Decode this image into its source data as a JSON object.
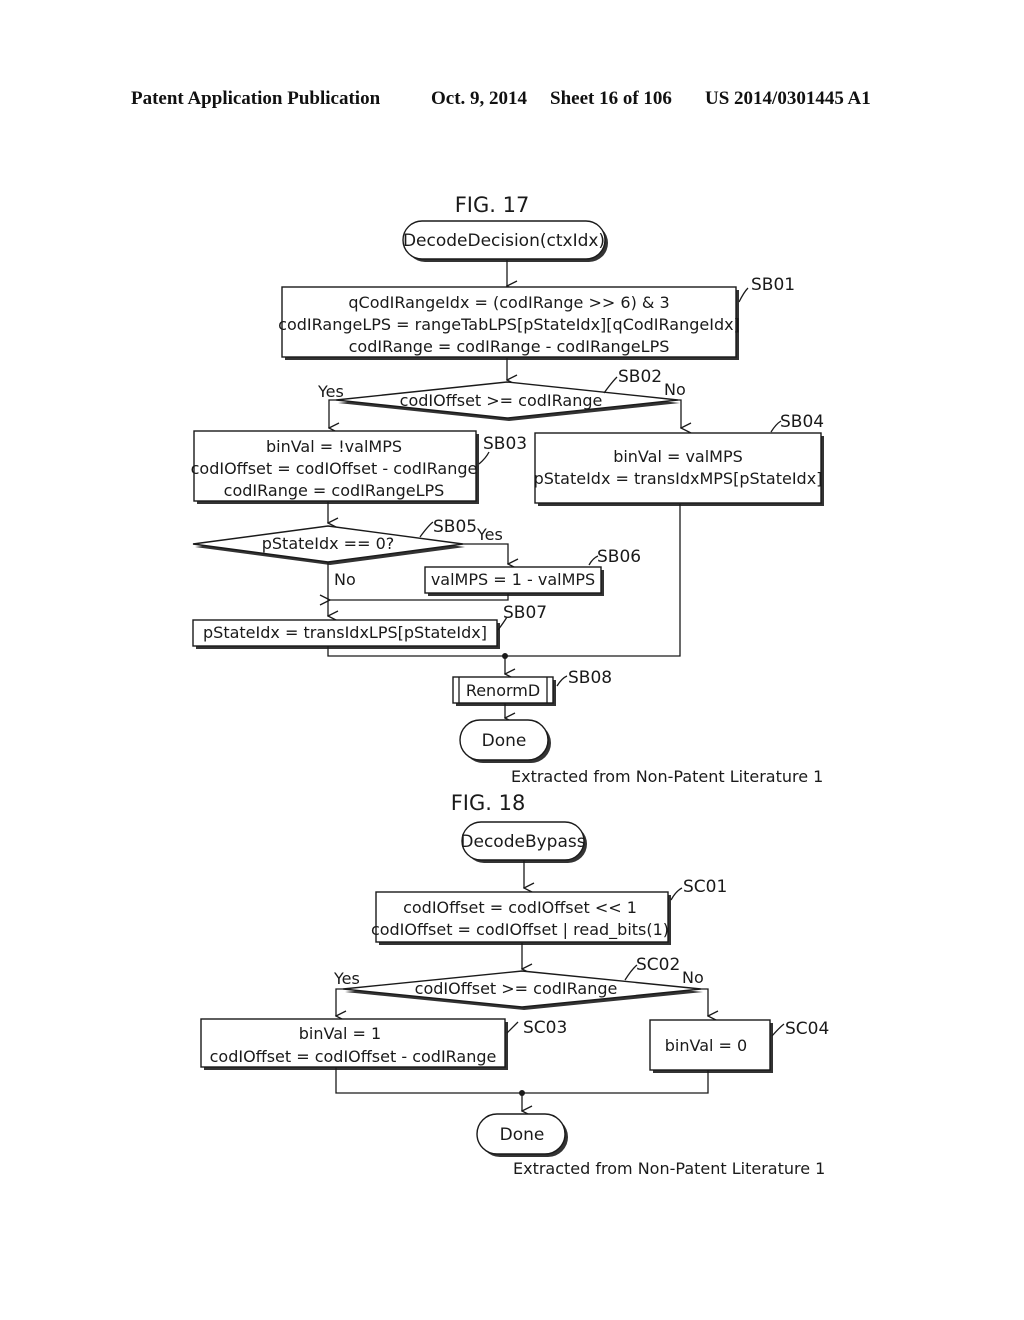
{
  "header": {
    "publication": "Patent Application Publication",
    "date": "Oct. 9, 2014",
    "sheet": "Sheet 16 of 106",
    "number": "US 2014/0301445 A1"
  },
  "fig17": {
    "title": "FIG. 17",
    "start": "DecodeDecision(ctxIdx)",
    "sb01": {
      "label": "SB01",
      "lines": [
        "qCodIRangeIdx = (codIRange >> 6) & 3",
        "codIRangeLPS = rangeTabLPS[pStateIdx][qCodIRangeIdx]",
        "codIRange = codIRange - codIRangeLPS"
      ]
    },
    "sb02": {
      "label": "SB02",
      "condition": "codIOffset >= codIRange",
      "yes": "Yes",
      "no": "No"
    },
    "sb03": {
      "label": "SB03",
      "lines": [
        "binVal = !valMPS",
        "codIOffset = codIOffset - codIRange",
        "codIRange = codIRangeLPS"
      ]
    },
    "sb04": {
      "label": "SB04",
      "lines": [
        "binVal = valMPS",
        "pStateIdx = transIdxMPS[pStateIdx]"
      ]
    },
    "sb05": {
      "label": "SB05",
      "condition": "pStateIdx == 0?",
      "yes": "Yes",
      "no": "No"
    },
    "sb06": {
      "label": "SB06",
      "text": "valMPS = 1 - valMPS"
    },
    "sb07": {
      "label": "SB07",
      "text": "pStateIdx = transIdxLPS[pStateIdx]"
    },
    "sb08": {
      "label": "SB08",
      "text": "RenormD"
    },
    "end": "Done",
    "note": "Extracted from Non-Patent Literature 1"
  },
  "fig18": {
    "title": "FIG. 18",
    "start": "DecodeBypass",
    "sc01": {
      "label": "SC01",
      "lines": [
        "codIOffset = codIOffset << 1",
        "codIOffset = codIOffset | read_bits(1)"
      ]
    },
    "sc02": {
      "label": "SC02",
      "condition": "codIOffset >= codIRange",
      "yes": "Yes",
      "no": "No"
    },
    "sc03": {
      "label": "SC03",
      "lines": [
        "binVal = 1",
        "codIOffset = codIOffset - codIRange"
      ]
    },
    "sc04": {
      "label": "SC04",
      "text": "binVal = 0"
    },
    "end": "Done",
    "note": "Extracted from Non-Patent Literature 1"
  }
}
